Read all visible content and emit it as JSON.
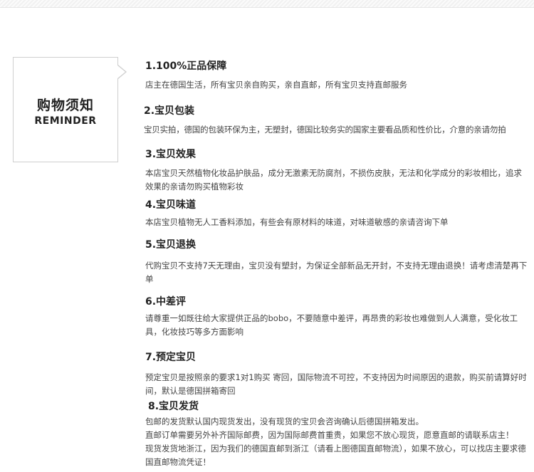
{
  "reminder": {
    "title_cn": "购物须知",
    "title_en": "REMINDER"
  },
  "sections": [
    {
      "title": "1.100%正品保障",
      "lines": [
        "店主在德国生活，所有宝贝亲自购买，亲自直邮，所有宝贝支持直邮服务"
      ]
    },
    {
      "title": "2.宝贝包装",
      "lines": [
        "宝贝实拍，德国的包装环保为主，无塑封，德国比较务实的国家主要看品质和性价比，介意的亲请勿拍"
      ]
    },
    {
      "title": "3.宝贝效果",
      "lines": [
        "本店宝贝天然植物化妆品护肤品，成分无激素无防腐剂，不损伤皮肤，无法和化学成分的彩妆相比，追求效果的亲请勿购买植物彩妆"
      ]
    },
    {
      "title": "4.宝贝味道",
      "lines": [
        "本店宝贝植物无人工香料添加，有些会有原材料的味道，对味道敏感的亲请咨询下单"
      ]
    },
    {
      "title": "5.宝贝退换",
      "lines": [
        "代购宝贝不支持7天无理由，宝贝没有塑封，为保证全部新品无开封，不支持无理由退换！请考虑清楚再下单"
      ]
    },
    {
      "title": "6.中差评",
      "lines": [
        "请尊重一如既往给大家提供正品的bobo，不要随意中差评，再昂贵的彩妆也难做到人人满意，受化妆工具，化妆技巧等多方面影响"
      ]
    },
    {
      "title": "7.预定宝贝",
      "lines": [
        "预定宝贝是按照亲的要求1对1购买 寄回，国际物流不可控，不支持因为时间原因的退款，购买前请算好时间，默认是德国拼箱寄回"
      ]
    },
    {
      "title": "8.宝贝发货",
      "lines": [
        "包邮的发货默认国内现货发出，没有现货的宝贝会咨询确认后德国拼箱发出。",
        "直邮订单需要另外补齐国际邮费，因为国际邮费首重贵，如果您不放心现货，愿意直邮的请联系店主！",
        "现货发货地浙江，因为我们的德国直邮到浙江（请看上图德国直邮物流），如果不放心，可以找店主要求德国直邮物流凭证！"
      ]
    }
  ]
}
